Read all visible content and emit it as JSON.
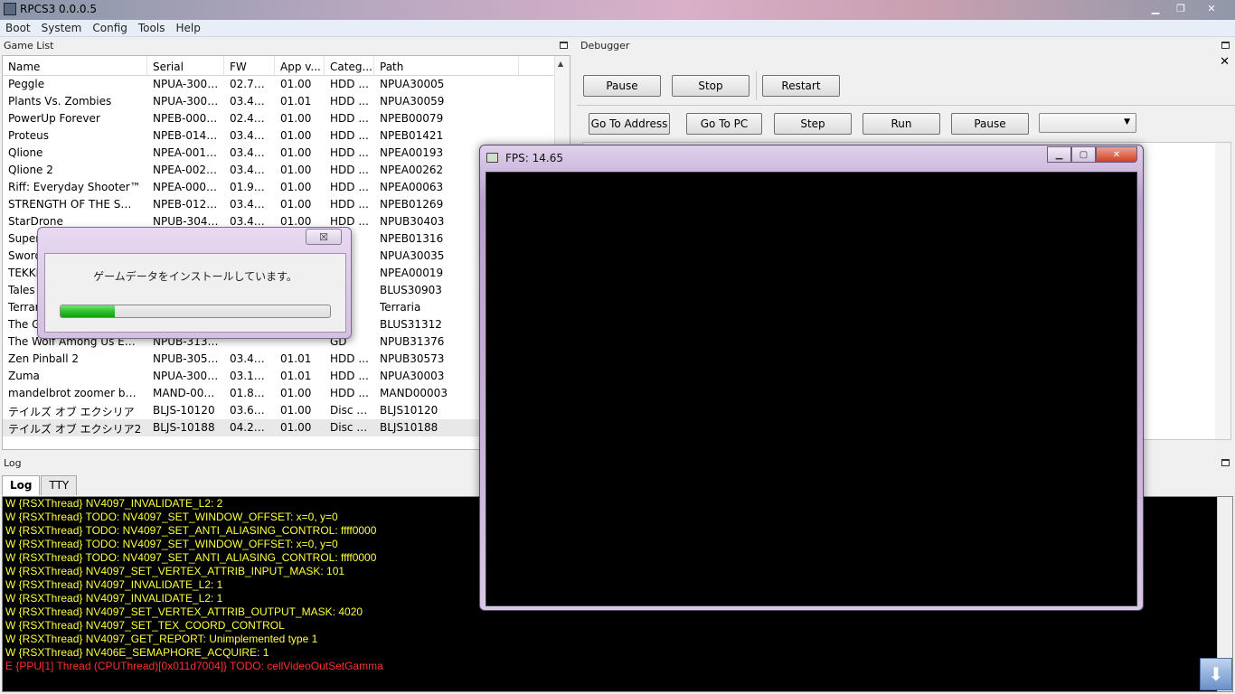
{
  "window": {
    "title": "RPCS3 0.0.0.5",
    "min_glyph": "▁",
    "max_glyph": "❐",
    "close_glyph": "✕"
  },
  "menu": [
    "Boot",
    "System",
    "Config",
    "Tools",
    "Help"
  ],
  "game_list": {
    "title": "Game List",
    "columns": [
      "Name",
      "Serial",
      "FW",
      "App v...",
      "Categ...",
      "Path"
    ],
    "rows": [
      [
        "Peggle",
        "NPUA-30005",
        "02.7000",
        "01.00",
        "HDD ...",
        "NPUA30005"
      ],
      [
        "Plants Vs. Zombies",
        "NPUA-30059",
        "03.4000",
        "01.01",
        "HDD ...",
        "NPUA30059"
      ],
      [
        "PowerUp Forever",
        "NPEB-00079",
        "02.4000",
        "01.00",
        "HDD ...",
        "NPEB00079"
      ],
      [
        "Proteus",
        "NPEB-01421",
        "03.4000",
        "01.00",
        "HDD ...",
        "NPEB01421"
      ],
      [
        "Qlione",
        "NPEA-00193",
        "03.4000",
        "01.00",
        "HDD ...",
        "NPEA00193"
      ],
      [
        "Qlione 2",
        "NPEA-00262",
        "03.4000",
        "01.00",
        "HDD ...",
        "NPEA00262"
      ],
      [
        "Riff: Everyday Shooter™",
        "NPEA-00063",
        "01.9000",
        "01.00",
        "HDD ...",
        "NPEA00063"
      ],
      [
        "STRENGTH OF THE SWOR...",
        "NPEB-01269",
        "03.4000",
        "01.00",
        "HDD ...",
        "NPEB01269"
      ],
      [
        "StarDrone",
        "NPUB-30403",
        "03.4000",
        "01.00",
        "HDD ...",
        "NPUB30403"
      ],
      [
        "Super",
        "",
        "",
        "",
        "",
        "NPEB01316"
      ],
      [
        "Sword",
        "",
        "",
        "",
        "",
        "NPUA30035"
      ],
      [
        "TEKKE",
        "",
        "",
        "",
        "",
        "NPEA00019"
      ],
      [
        "Tales o",
        "",
        "",
        "",
        "G...",
        "BLUS30903"
      ],
      [
        "Terrar",
        "",
        "",
        "",
        "",
        "Terraria"
      ],
      [
        "The G",
        "",
        "",
        "",
        "G...",
        "BLUS31312"
      ],
      [
        "The Wolf Among Us Episo...",
        "NPUB-31376",
        "",
        "",
        "GD",
        "NPUB31376"
      ],
      [
        "Zen Pinball 2",
        "NPUB-30573",
        "03.4000",
        "01.01",
        "HDD ...",
        "NPUB30573"
      ],
      [
        "Zuma",
        "NPUA-30003",
        "03.1000",
        "01.01",
        "HDD ...",
        "NPUA30003"
      ],
      [
        "mandelbrot zoomer by zer...",
        "MAND-00003",
        "01.8000",
        "01.00",
        "HDD ...",
        "MAND00003"
      ],
      [
        "テイルズ オブ エクシリア",
        "BLJS-10120",
        "03.6600",
        "01.00",
        "Disc G...",
        "BLJS10120"
      ],
      [
        "テイルズ オブ エクシリア2",
        "BLJS-10188",
        "04.2500",
        "01.00",
        "Disc G...",
        "BLJS10188"
      ]
    ]
  },
  "debugger": {
    "title": "Debugger",
    "close_glyph": "✕",
    "row1": [
      "Pause",
      "Stop",
      "Restart"
    ],
    "row2": [
      "Go To Address",
      "Go To PC",
      "Step",
      "Run",
      "Pause"
    ]
  },
  "log": {
    "title": "Log",
    "tabs": [
      "Log",
      "TTY"
    ],
    "lines": [
      {
        "text": "W {RSXThread} NV4097_INVALIDATE_L2: 2",
        "level": "warn"
      },
      {
        "text": "W {RSXThread} TODO: NV4097_SET_WINDOW_OFFSET: x=0, y=0",
        "level": "warn"
      },
      {
        "text": "W {RSXThread} TODO: NV4097_SET_ANTI_ALIASING_CONTROL: ffff0000",
        "level": "warn"
      },
      {
        "text": "W {RSXThread} TODO: NV4097_SET_WINDOW_OFFSET: x=0, y=0",
        "level": "warn"
      },
      {
        "text": "W {RSXThread} TODO: NV4097_SET_ANTI_ALIASING_CONTROL: ffff0000",
        "level": "warn"
      },
      {
        "text": "W {RSXThread} NV4097_SET_VERTEX_ATTRIB_INPUT_MASK: 101",
        "level": "warn"
      },
      {
        "text": "W {RSXThread} NV4097_INVALIDATE_L2: 1",
        "level": "warn"
      },
      {
        "text": "W {RSXThread} NV4097_INVALIDATE_L2: 1",
        "level": "warn"
      },
      {
        "text": "W {RSXThread} NV4097_SET_VERTEX_ATTRIB_OUTPUT_MASK: 4020",
        "level": "warn"
      },
      {
        "text": "W {RSXThread} NV4097_SET_TEX_COORD_CONTROL",
        "level": "warn"
      },
      {
        "text": "W {RSXThread} NV4097_GET_REPORT: Unimplemented type 1",
        "level": "warn"
      },
      {
        "text": "W {RSXThread} NV406E_SEMAPHORE_ACQUIRE: 1",
        "level": "warn"
      },
      {
        "text": "E {PPU[1] Thread (CPUThread)[0x011d7004]} TODO: cellVideoOutSetGamma",
        "level": "err"
      }
    ]
  },
  "install_dialog": {
    "message": "ゲームデータをインストールしています。",
    "progress": 0.2,
    "close_glyph": "☒"
  },
  "fps_window": {
    "title": "FPS: 14.65",
    "min_glyph": "▁",
    "max_glyph": "▢",
    "close_glyph": "✕"
  },
  "colors": {
    "warn": "#ffff40",
    "error": "#ff3030",
    "progress": "#30c030"
  }
}
